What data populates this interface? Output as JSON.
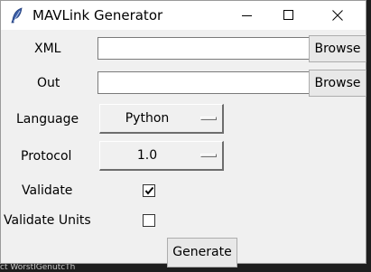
{
  "window": {
    "title": "MAVLink Generator",
    "controls": {
      "minimize": "minimize",
      "maximize": "maximize",
      "close": "close"
    }
  },
  "form": {
    "xml": {
      "label": "XML",
      "value": "",
      "browse_label": "Browse"
    },
    "out": {
      "label": "Out",
      "value": "",
      "browse_label": "Browse"
    },
    "language": {
      "label": "Language",
      "selected": "Python"
    },
    "protocol": {
      "label": "Protocol",
      "selected": "1.0"
    },
    "validate": {
      "label": "Validate",
      "checked": true
    },
    "validate_units": {
      "label": "Validate Units",
      "checked": false
    },
    "generate_label": "Generate"
  },
  "background": {
    "visible_text": "ct WorstIGenutcTh"
  },
  "colors": {
    "window_bg": "#f0f0f0",
    "titlebar_bg": "#ffffff",
    "desktop_bg": "#1e1e1e"
  }
}
